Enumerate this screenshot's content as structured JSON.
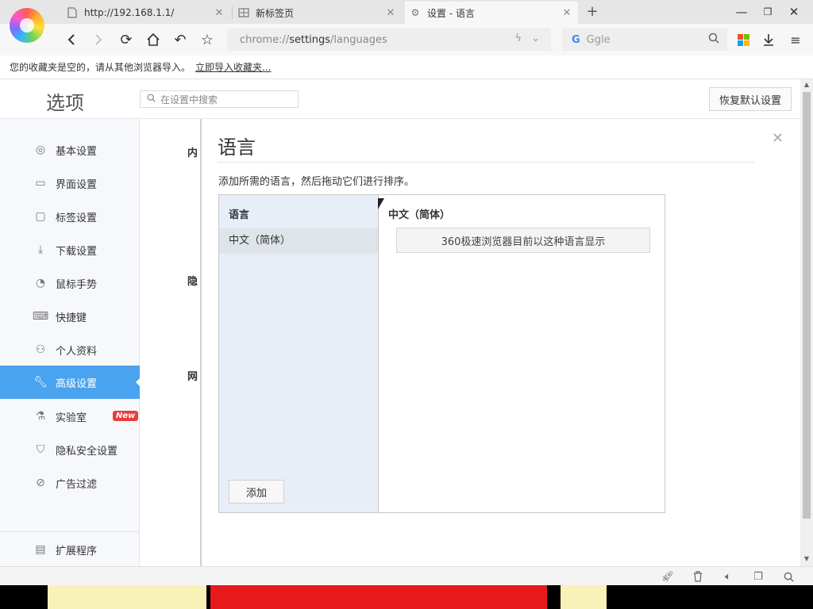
{
  "browser": {
    "tabs": [
      {
        "title": "http://192.168.1.1/",
        "icon": "page-icon",
        "active": false
      },
      {
        "title": "新标签页",
        "icon": "grid-icon",
        "active": false
      },
      {
        "title": "设置 - 语言",
        "icon": "gear-icon",
        "active": true
      }
    ],
    "address": {
      "scheme": "chrome://",
      "path": "settings",
      "rest": "/languages"
    },
    "search_placeholder": "Ggle",
    "bookmark_notice": "您的收藏夹是空的，请从其他浏览器导入。",
    "bookmark_link": "立即导入收藏夹..."
  },
  "settings": {
    "page_title": "选项",
    "search_placeholder": "在设置中搜索",
    "restore_button": "恢复默认设置",
    "sidebar": [
      {
        "label": "基本设置",
        "icon": "circle-icon"
      },
      {
        "label": "界面设置",
        "icon": "window-icon"
      },
      {
        "label": "标签设置",
        "icon": "tab-icon"
      },
      {
        "label": "下载设置",
        "icon": "download-icon"
      },
      {
        "label": "鼠标手势",
        "icon": "mouse-icon"
      },
      {
        "label": "快捷键",
        "icon": "keyboard-icon"
      },
      {
        "label": "个人资料",
        "icon": "person-icon"
      },
      {
        "label": "高级设置",
        "icon": "wrench-icon",
        "active": true
      },
      {
        "label": "实验室",
        "icon": "flask-icon",
        "badge": "New"
      },
      {
        "label": "隐私安全设置",
        "icon": "shield-icon"
      },
      {
        "label": "广告过滤",
        "icon": "block-icon"
      }
    ],
    "sidebar_bottom": {
      "label": "扩展程序",
      "icon": "extension-icon"
    },
    "partial_labels": [
      "内",
      "隐",
      "网"
    ]
  },
  "dialog": {
    "title": "语言",
    "description": "添加所需的语言，然后拖动它们进行排序。",
    "list_header": "语言",
    "languages": [
      "中文（简体）"
    ],
    "selected_language": "中文（简体）",
    "display_button": "360极速浏览器目前以这种语言显示",
    "add_button": "添加"
  },
  "colors": {
    "accent": "#4aa3ee",
    "badge": "#e93d3d",
    "list_bg": "#e8eef8"
  }
}
